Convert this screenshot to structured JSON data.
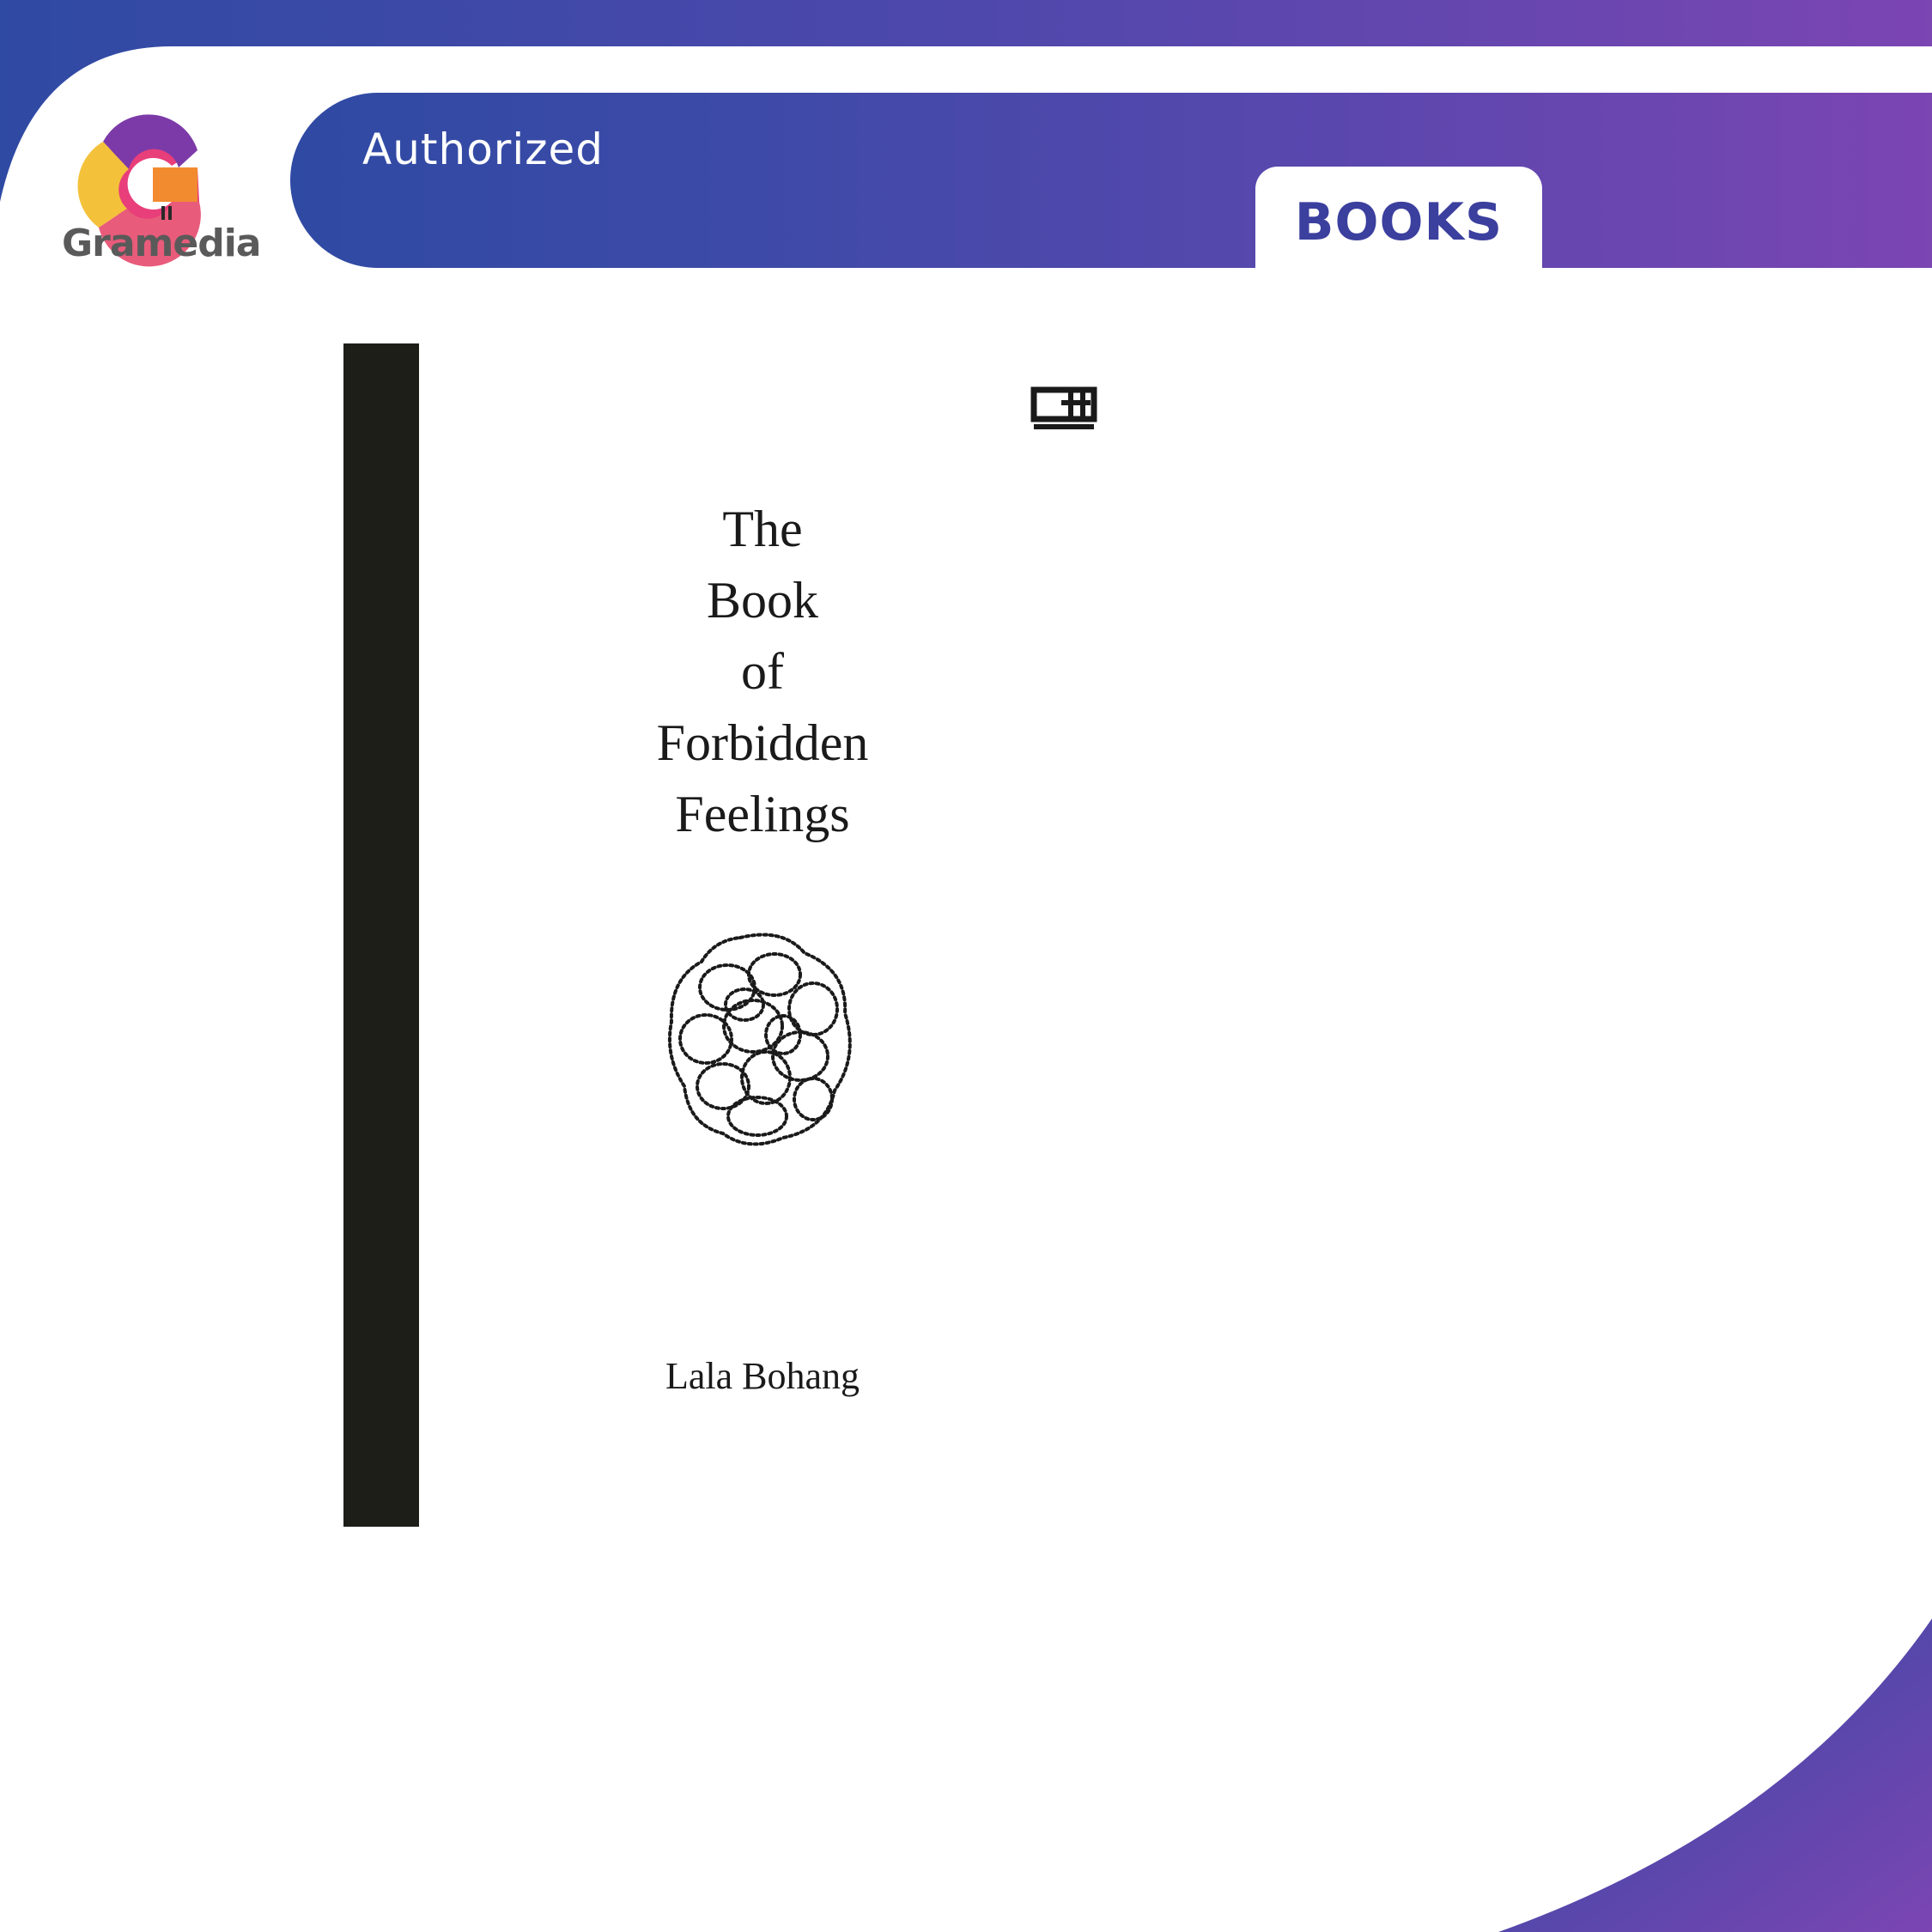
{
  "brand": {
    "name": "Gramedia",
    "logo_icon": "gramedia-g-logo"
  },
  "header": {
    "badge": "Authorized",
    "category": "BOOKS",
    "colors": {
      "gradient_start": "#2f4aa3",
      "gradient_end": "#7b45b2",
      "category_text": "#3b3f9e"
    }
  },
  "cover": {
    "publisher_logo": "gm-publisher-logo",
    "title_lines": [
      "The",
      "Book",
      "of",
      "Forbidden",
      "Feelings"
    ],
    "illustration": "scribble-illustration",
    "author": "Lala Bohang",
    "spine_color": "#1e1e19"
  }
}
